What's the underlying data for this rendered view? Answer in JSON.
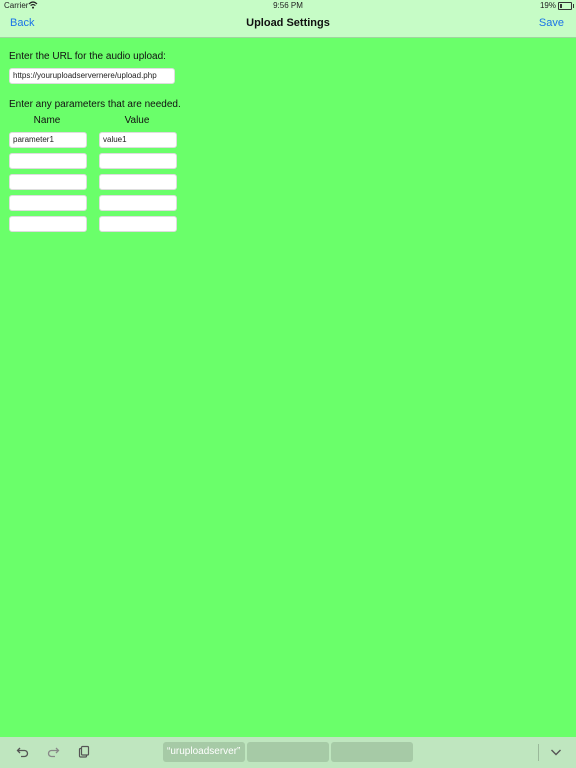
{
  "status_bar": {
    "carrier": "Carrier",
    "time": "9:56 PM",
    "battery": "19%",
    "battery_level": 0.19
  },
  "nav": {
    "back_label": "Back",
    "title": "Upload Settings",
    "save_label": "Save"
  },
  "form": {
    "url_label": "Enter the URL for the audio upload:",
    "url_value": "https://youruploadservernere/upload.php",
    "params_label": "Enter any parameters that are needed.",
    "name_header": "Name",
    "value_header": "Value",
    "params": [
      {
        "name": "parameter1",
        "value": "value1"
      },
      {
        "name": "",
        "value": ""
      },
      {
        "name": "",
        "value": ""
      },
      {
        "name": "",
        "value": ""
      },
      {
        "name": "",
        "value": ""
      }
    ]
  },
  "bottom_bar": {
    "icons": [
      "undo-icon",
      "redo-icon",
      "paste-icon",
      "chevron-down-icon"
    ],
    "suggestions": [
      "“uruploadserver”",
      "",
      ""
    ]
  },
  "colors": {
    "background": "#6aff6a",
    "bar": "#c6fcc6",
    "accent": "#1a73e8"
  }
}
